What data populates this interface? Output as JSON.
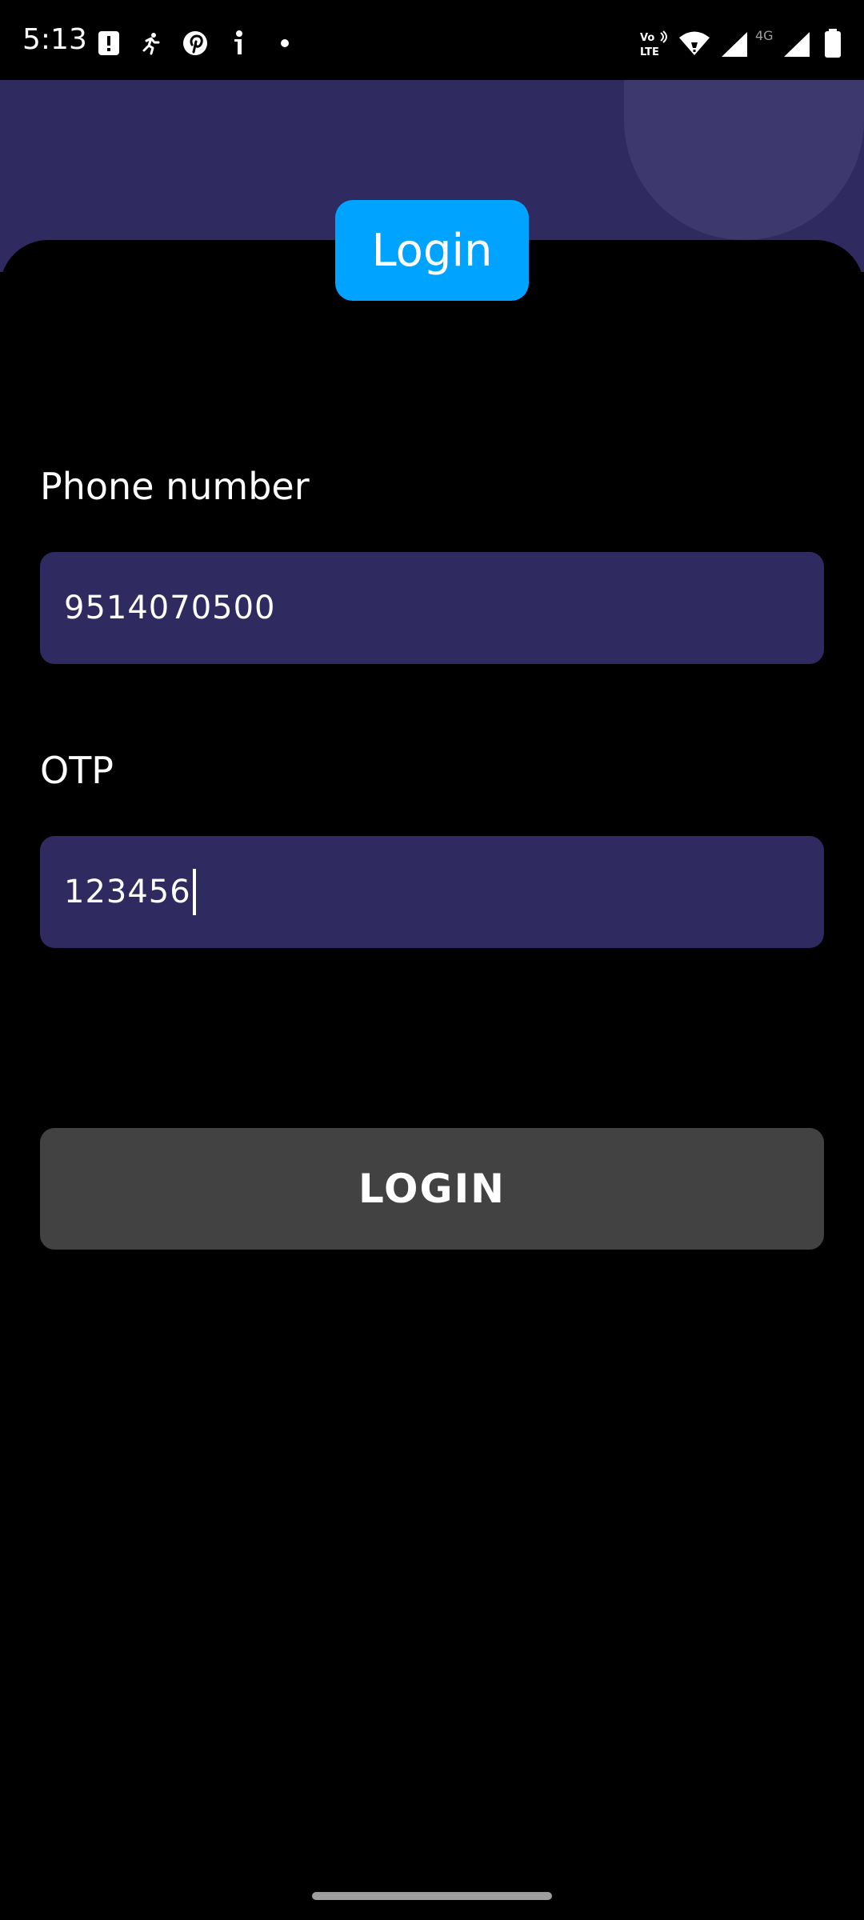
{
  "status_bar": {
    "time": "5:13",
    "notification_icons": [
      "alert-icon",
      "running-figure-icon",
      "pinterest-icon",
      "info-icon",
      "dot-icon"
    ],
    "system_icons": [
      "volte-icon",
      "wifi-icon",
      "signal-icon",
      "4g-signal-icon",
      "battery-icon"
    ],
    "network_label": "4G",
    "volte_label": "Vo LTE"
  },
  "header": {
    "title": "Login",
    "band_color": "#2f2a5f",
    "chip_color": "#00a3ff"
  },
  "form": {
    "phone": {
      "label": "Phone number",
      "value": "9514070500"
    },
    "otp": {
      "label": "OTP",
      "value": "123456"
    },
    "submit_label": "LOGIN",
    "input_color": "#2f2a5f",
    "button_color": "#424242"
  }
}
